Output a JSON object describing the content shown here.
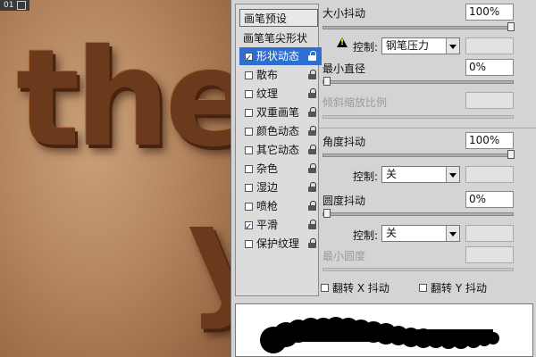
{
  "document": {
    "tab_label": "01"
  },
  "canvas": {
    "artwork_text": "the",
    "descender_text": "y"
  },
  "brush_panel": {
    "preset_button": "画笔预设",
    "tip_shape_label": "画笔笔尖形状",
    "options": [
      {
        "label": "形状动态",
        "checked": true,
        "selected": true
      },
      {
        "label": "散布",
        "checked": false,
        "selected": false
      },
      {
        "label": "纹理",
        "checked": false,
        "selected": false
      },
      {
        "label": "双重画笔",
        "checked": false,
        "selected": false
      },
      {
        "label": "颜色动态",
        "checked": false,
        "selected": false
      },
      {
        "label": "其它动态",
        "checked": false,
        "selected": false
      },
      {
        "label": "杂色",
        "checked": false,
        "selected": false
      },
      {
        "label": "湿边",
        "checked": false,
        "selected": false
      },
      {
        "label": "喷枪",
        "checked": false,
        "selected": false
      },
      {
        "label": "平滑",
        "checked": true,
        "selected": false
      },
      {
        "label": "保护纹理",
        "checked": false,
        "selected": false
      }
    ],
    "size_jitter": {
      "label": "大小抖动",
      "value": "100%"
    },
    "size_control": {
      "label": "控制:",
      "value": "钢笔压力"
    },
    "min_diameter": {
      "label": "最小直径",
      "value": "0%"
    },
    "tilt_scale": {
      "label": "倾斜缩放比例"
    },
    "angle_jitter": {
      "label": "角度抖动",
      "value": "100%"
    },
    "angle_control": {
      "label": "控制:",
      "value": "关"
    },
    "roundness_jitter": {
      "label": "圆度抖动",
      "value": "0%"
    },
    "roundness_control": {
      "label": "控制:",
      "value": "关"
    },
    "min_roundness": {
      "label": "最小圆度"
    },
    "flip_x": {
      "label": "翻转 X 抖动",
      "checked": false
    },
    "flip_y": {
      "label": "翻转 Y 抖动",
      "checked": false
    }
  },
  "colors": {
    "selected_bg": "#2d6ecf",
    "panel_bg": "#d4d4d4",
    "chocolate": "#6b3a1c"
  }
}
